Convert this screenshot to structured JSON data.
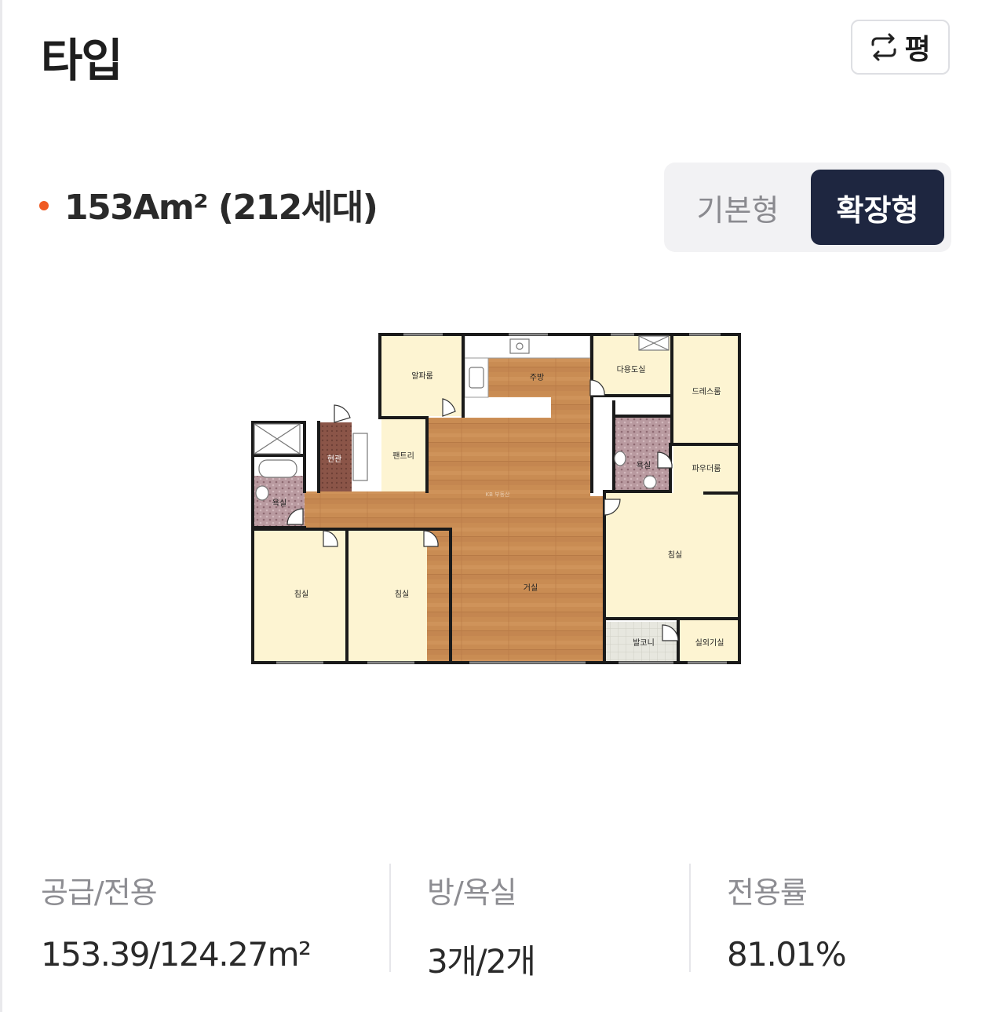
{
  "header": {
    "title": "타입",
    "unit_toggle_label": "평"
  },
  "type": {
    "name": "153Am² (212세대)",
    "dot_color": "#f05a22"
  },
  "variant_tabs": [
    {
      "label": "기본형",
      "active": false
    },
    {
      "label": "확장형",
      "active": true
    }
  ],
  "floor_plan": {
    "rooms": {
      "alpha": "알파룸",
      "kitchen": "주방",
      "utility": "다용도실",
      "dress": "드레스룸",
      "entrance": "현관",
      "pantry": "팬트리",
      "bath_left": "욕실",
      "bath_right": "욕실",
      "powder": "파우더룸",
      "living": "거실",
      "bed1": "침실",
      "bed2": "침실",
      "bed3": "침실",
      "balcony": "발코니",
      "outdoor_unit": "실외기실"
    },
    "watermark": "KB 부동산"
  },
  "stats": [
    {
      "label": "공급/전용",
      "value": "153.39/124.27m²"
    },
    {
      "label": "방/욕실",
      "value": "3개/2개"
    },
    {
      "label": "전용률",
      "value": "81.01%"
    }
  ],
  "colors": {
    "active_tab_bg": "#1e2640",
    "wood": "#c98c53",
    "room_fill": "#fdf4d2",
    "tile": "#b99aa0"
  }
}
